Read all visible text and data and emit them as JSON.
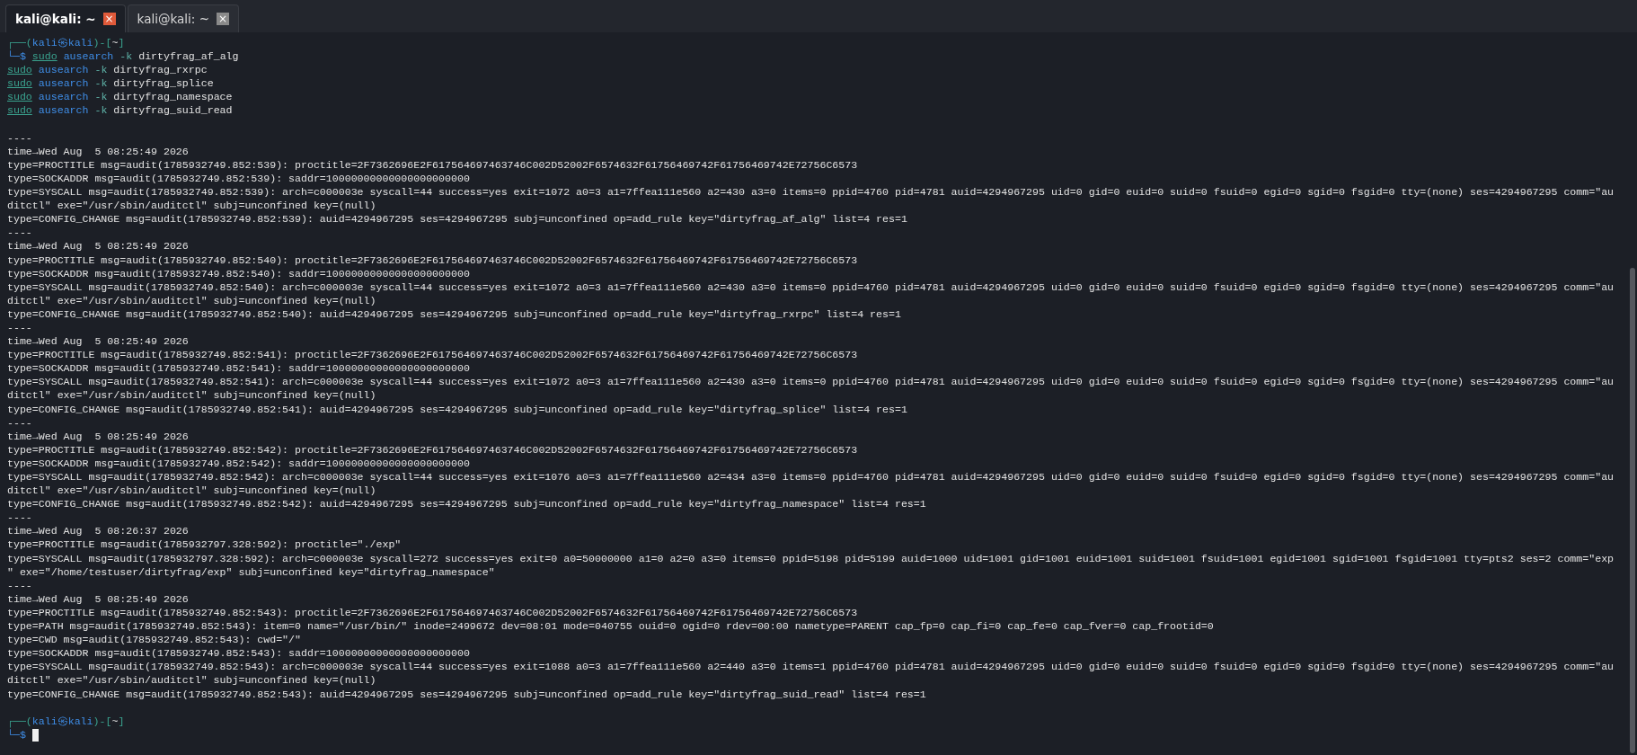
{
  "tabs": [
    {
      "label": "kali@kali: ~",
      "selected": true,
      "close": "×"
    },
    {
      "label": "kali@kali: ~",
      "selected": false,
      "close": "×"
    }
  ],
  "prompts": [
    {
      "segments": [
        {
          "kind": "frame",
          "text": "┌──("
        },
        {
          "kind": "user",
          "text": "kali"
        },
        {
          "kind": "user",
          "text": "㉿"
        },
        {
          "kind": "user",
          "text": "kali"
        },
        {
          "kind": "frame",
          "text": ")-["
        },
        {
          "kind": "dir",
          "text": "~"
        },
        {
          "kind": "frame",
          "text": "]"
        }
      ],
      "dollar": "└─$"
    },
    {
      "segments": [
        {
          "kind": "frame",
          "text": "┌──("
        },
        {
          "kind": "user",
          "text": "kali"
        },
        {
          "kind": "user",
          "text": "㉿"
        },
        {
          "kind": "user",
          "text": "kali"
        },
        {
          "kind": "frame",
          "text": ")-["
        },
        {
          "kind": "dir",
          "text": "~"
        },
        {
          "kind": "frame",
          "text": "]"
        }
      ],
      "dollar": "└─$"
    }
  ],
  "commands": [
    {
      "sudo": "sudo",
      "program": "ausearch",
      "flag": "-k",
      "arg": "dirtyfrag_af_alg"
    },
    {
      "sudo": "sudo",
      "program": "ausearch",
      "flag": "-k",
      "arg": "dirtyfrag_rxrpc"
    },
    {
      "sudo": "sudo",
      "program": "ausearch",
      "flag": "-k",
      "arg": "dirtyfrag_splice"
    },
    {
      "sudo": "sudo",
      "program": "ausearch",
      "flag": "-k",
      "arg": "dirtyfrag_namespace"
    },
    {
      "sudo": "sudo",
      "program": "ausearch",
      "flag": "-k",
      "arg": "dirtyfrag_suid_read"
    }
  ],
  "blocks": [
    {
      "separator": "----",
      "lines": [
        "time→Wed Aug  5 08:25:49 2026",
        "type=PROCTITLE msg=audit(1785932749.852:539): proctitle=2F7362696E2F617564697463746C002D52002F6574632F61756469742F61756469742E72756C6573",
        "type=SOCKADDR msg=audit(1785932749.852:539): saddr=10000000000000000000000",
        "type=SYSCALL msg=audit(1785932749.852:539): arch=c000003e syscall=44 success=yes exit=1072 a0=3 a1=7ffea111e560 a2=430 a3=0 items=0 ppid=4760 pid=4781 auid=4294967295 uid=0 gid=0 euid=0 suid=0 fsuid=0 egid=0 sgid=0 fsgid=0 tty=(none) ses=4294967295 comm=\"au",
        "ditctl\" exe=\"/usr/sbin/auditctl\" subj=unconfined key=(null)",
        "type=CONFIG_CHANGE msg=audit(1785932749.852:539): auid=4294967295 ses=4294967295 subj=unconfined op=add_rule key=\"dirtyfrag_af_alg\" list=4 res=1"
      ]
    },
    {
      "separator": "----",
      "lines": [
        "time→Wed Aug  5 08:25:49 2026",
        "type=PROCTITLE msg=audit(1785932749.852:540): proctitle=2F7362696E2F617564697463746C002D52002F6574632F61756469742F61756469742E72756C6573",
        "type=SOCKADDR msg=audit(1785932749.852:540): saddr=10000000000000000000000",
        "type=SYSCALL msg=audit(1785932749.852:540): arch=c000003e syscall=44 success=yes exit=1072 a0=3 a1=7ffea111e560 a2=430 a3=0 items=0 ppid=4760 pid=4781 auid=4294967295 uid=0 gid=0 euid=0 suid=0 fsuid=0 egid=0 sgid=0 fsgid=0 tty=(none) ses=4294967295 comm=\"au",
        "ditctl\" exe=\"/usr/sbin/auditctl\" subj=unconfined key=(null)",
        "type=CONFIG_CHANGE msg=audit(1785932749.852:540): auid=4294967295 ses=4294967295 subj=unconfined op=add_rule key=\"dirtyfrag_rxrpc\" list=4 res=1"
      ]
    },
    {
      "separator": "----",
      "lines": [
        "time→Wed Aug  5 08:25:49 2026",
        "type=PROCTITLE msg=audit(1785932749.852:541): proctitle=2F7362696E2F617564697463746C002D52002F6574632F61756469742F61756469742E72756C6573",
        "type=SOCKADDR msg=audit(1785932749.852:541): saddr=10000000000000000000000",
        "type=SYSCALL msg=audit(1785932749.852:541): arch=c000003e syscall=44 success=yes exit=1072 a0=3 a1=7ffea111e560 a2=430 a3=0 items=0 ppid=4760 pid=4781 auid=4294967295 uid=0 gid=0 euid=0 suid=0 fsuid=0 egid=0 sgid=0 fsgid=0 tty=(none) ses=4294967295 comm=\"au",
        "ditctl\" exe=\"/usr/sbin/auditctl\" subj=unconfined key=(null)",
        "type=CONFIG_CHANGE msg=audit(1785932749.852:541): auid=4294967295 ses=4294967295 subj=unconfined op=add_rule key=\"dirtyfrag_splice\" list=4 res=1"
      ]
    },
    {
      "separator": "----",
      "lines": [
        "time→Wed Aug  5 08:25:49 2026",
        "type=PROCTITLE msg=audit(1785932749.852:542): proctitle=2F7362696E2F617564697463746C002D52002F6574632F61756469742F61756469742E72756C6573",
        "type=SOCKADDR msg=audit(1785932749.852:542): saddr=10000000000000000000000",
        "type=SYSCALL msg=audit(1785932749.852:542): arch=c000003e syscall=44 success=yes exit=1076 a0=3 a1=7ffea111e560 a2=434 a3=0 items=0 ppid=4760 pid=4781 auid=4294967295 uid=0 gid=0 euid=0 suid=0 fsuid=0 egid=0 sgid=0 fsgid=0 tty=(none) ses=4294967295 comm=\"au",
        "ditctl\" exe=\"/usr/sbin/auditctl\" subj=unconfined key=(null)",
        "type=CONFIG_CHANGE msg=audit(1785932749.852:542): auid=4294967295 ses=4294967295 subj=unconfined op=add_rule key=\"dirtyfrag_namespace\" list=4 res=1"
      ]
    },
    {
      "separator": "----",
      "lines": [
        "time→Wed Aug  5 08:26:37 2026",
        "type=PROCTITLE msg=audit(1785932797.328:592): proctitle=\"./exp\"",
        "type=SYSCALL msg=audit(1785932797.328:592): arch=c000003e syscall=272 success=yes exit=0 a0=50000000 a1=0 a2=0 a3=0 items=0 ppid=5198 pid=5199 auid=1000 uid=1001 gid=1001 euid=1001 suid=1001 fsuid=1001 egid=1001 sgid=1001 fsgid=1001 tty=pts2 ses=2 comm=\"exp",
        "\" exe=\"/home/testuser/dirtyfrag/exp\" subj=unconfined key=\"dirtyfrag_namespace\""
      ]
    },
    {
      "separator": "----",
      "lines": [
        "time→Wed Aug  5 08:25:49 2026",
        "type=PROCTITLE msg=audit(1785932749.852:543): proctitle=2F7362696E2F617564697463746C002D52002F6574632F61756469742F61756469742E72756C6573",
        "type=PATH msg=audit(1785932749.852:543): item=0 name=\"/usr/bin/\" inode=2499672 dev=08:01 mode=040755 ouid=0 ogid=0 rdev=00:00 nametype=PARENT cap_fp=0 cap_fi=0 cap_fe=0 cap_fver=0 cap_frootid=0",
        "type=CWD msg=audit(1785932749.852:543): cwd=\"/\"",
        "type=SOCKADDR msg=audit(1785932749.852:543): saddr=10000000000000000000000",
        "type=SYSCALL msg=audit(1785932749.852:543): arch=c000003e syscall=44 success=yes exit=1088 a0=3 a1=7ffea111e560 a2=440 a3=0 items=1 ppid=4760 pid=4781 auid=4294967295 uid=0 gid=0 euid=0 suid=0 fsuid=0 egid=0 sgid=0 fsgid=0 tty=(none) ses=4294967295 comm=\"au",
        "ditctl\" exe=\"/usr/sbin/auditctl\" subj=unconfined key=(null)",
        "type=CONFIG_CHANGE msg=audit(1785932749.852:543): auid=4294967295 ses=4294967295 subj=unconfined op=add_rule key=\"dirtyfrag_suid_read\" list=4 res=1"
      ]
    }
  ]
}
